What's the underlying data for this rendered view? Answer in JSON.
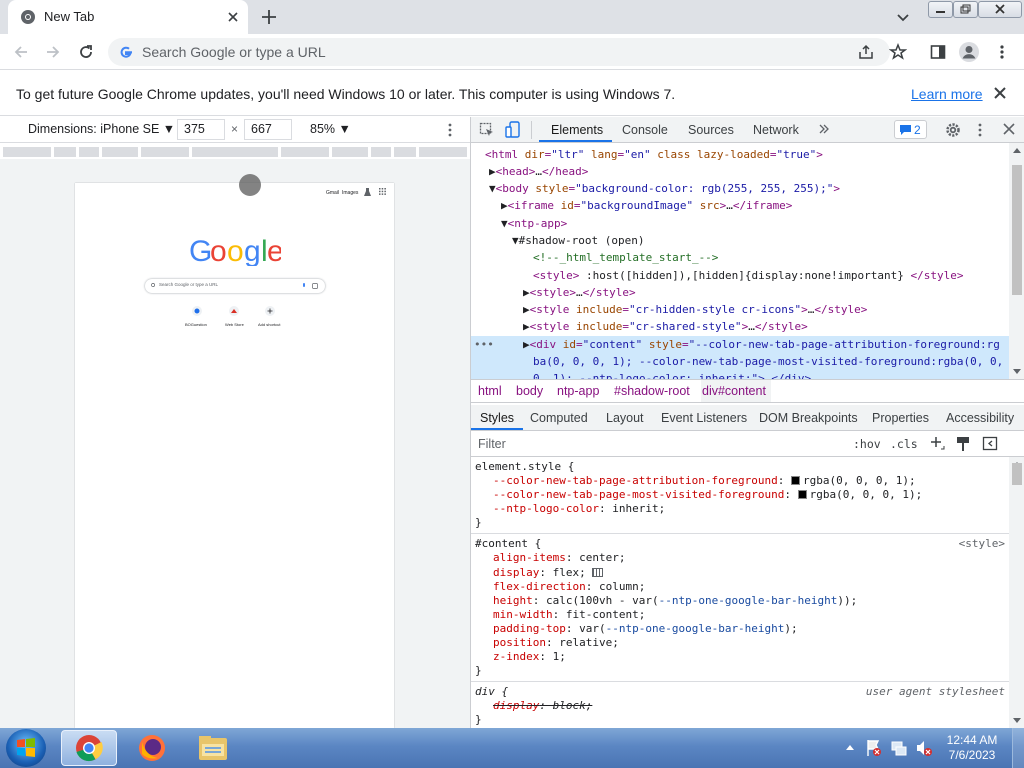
{
  "browser": {
    "tab_title": "New Tab",
    "omnibox_placeholder": "Search Google or type a URL"
  },
  "infobar": {
    "message": "To get future Google Chrome updates, you'll need Windows 10 or later. This computer is using Windows 7.",
    "link": "Learn more"
  },
  "device_toolbar": {
    "dimensions_label": "Dimensions: iPhone SE ▼",
    "width": "375",
    "height": "667",
    "times": "×",
    "zoom": "85% ▼"
  },
  "mobile_page": {
    "gmail": "Gmail",
    "images": "Images",
    "search_placeholder": "Search Google or type a URL",
    "shortcuts": [
      "BOGuestion",
      "Web Store",
      "Add shortcut"
    ]
  },
  "devtools": {
    "tabs": [
      "Elements",
      "Console",
      "Sources",
      "Network"
    ],
    "issues_count": "2",
    "breadcrumbs": [
      "html",
      "body",
      "ntp-app",
      "#shadow-root",
      "div#content"
    ],
    "style_tabs": [
      "Styles",
      "Computed",
      "Layout",
      "Event Listeners",
      "DOM Breakpoints",
      "Properties",
      "Accessibility"
    ],
    "filter_placeholder": "Filter",
    "hov": ":hov",
    "cls": ".cls"
  },
  "taskbar": {
    "time": "12:44 AM",
    "date": "7/6/2023"
  },
  "colors": {
    "accent": "#1a73e8",
    "tag": "#881280",
    "attr_name": "#994500",
    "attr_value": "#1a1aa6",
    "css_prop": "#c80000",
    "selection": "#cfe8fc"
  }
}
